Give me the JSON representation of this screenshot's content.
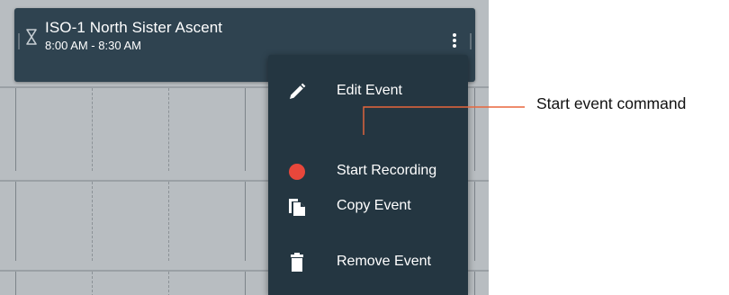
{
  "event": {
    "title": "ISO-1 North Sister Ascent",
    "time": "8:00 AM - 8:30 AM",
    "icon": "hourglass-icon",
    "menu_icon": "more-vertical-icon"
  },
  "menu": {
    "items": [
      {
        "label": "Edit Event",
        "icon": "pencil-icon"
      },
      {
        "label": "Start Recording",
        "icon": "record-icon"
      },
      {
        "label": "Copy Event",
        "icon": "copy-icon"
      },
      {
        "label": "Remove Event",
        "icon": "trash-icon"
      }
    ]
  },
  "callout": {
    "label": "Start event command",
    "color": "#e8673c"
  },
  "colors": {
    "card": "#2f4350",
    "menu": "#243641",
    "grid": "#b8bdc1",
    "record": "#e8473b"
  }
}
